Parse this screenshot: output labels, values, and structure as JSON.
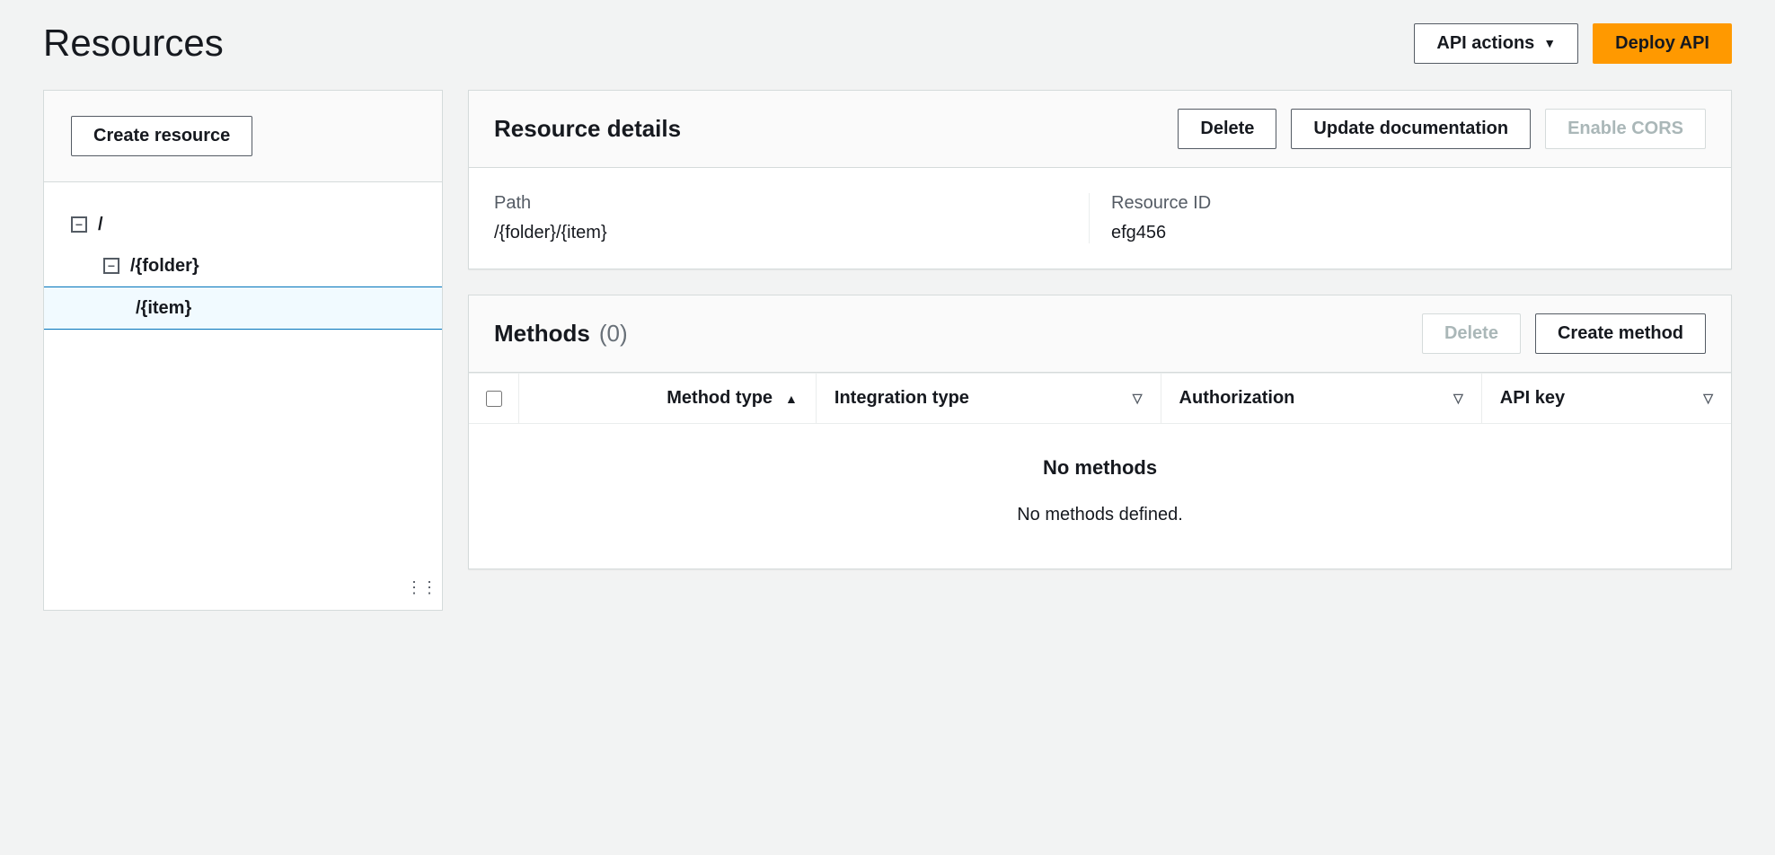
{
  "header": {
    "title": "Resources",
    "api_actions_label": "API actions",
    "deploy_label": "Deploy API"
  },
  "sidebar": {
    "create_label": "Create resource",
    "tree": {
      "root": "/",
      "folder": "/{folder}",
      "item": "/{item}"
    }
  },
  "details": {
    "title": "Resource details",
    "delete_label": "Delete",
    "update_doc_label": "Update documentation",
    "enable_cors_label": "Enable CORS",
    "path_label": "Path",
    "path_value": "/{folder}/{item}",
    "resource_id_label": "Resource ID",
    "resource_id_value": "efg456"
  },
  "methods": {
    "title": "Methods",
    "count": "(0)",
    "delete_label": "Delete",
    "create_label": "Create method",
    "columns": {
      "method_type": "Method type",
      "integration_type": "Integration type",
      "authorization": "Authorization",
      "api_key": "API key"
    },
    "empty_title": "No methods",
    "empty_sub": "No methods defined."
  }
}
